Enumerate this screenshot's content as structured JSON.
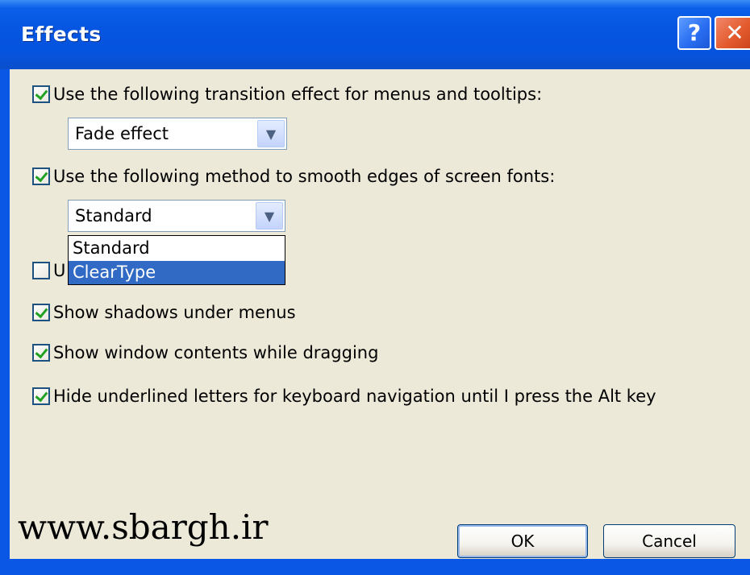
{
  "window": {
    "title": "Effects",
    "help_label": "?",
    "close_label": "✕"
  },
  "options": {
    "transition": {
      "label": "Use the following transition effect for menus and tooltips:",
      "checked": true,
      "selected_value": "Fade effect"
    },
    "smoothing": {
      "label": "Use the following method to smooth edges of screen fonts:",
      "checked": true,
      "selected_value": "Standard",
      "dropdown_options": [
        "Standard",
        "ClearType"
      ],
      "highlighted_option": "ClearType"
    },
    "hidden_option": {
      "visible_text": "U",
      "checked": false
    },
    "shadows": {
      "label": "Show shadows under menus",
      "checked": true
    },
    "drag_contents": {
      "label": "Show window contents while dragging",
      "checked": true
    },
    "hide_underline": {
      "label": "Hide underlined letters for keyboard navigation until I press the Alt key",
      "checked": true
    }
  },
  "buttons": {
    "ok": "OK",
    "cancel": "Cancel"
  },
  "watermark": "www.sbargh.ir",
  "icons": {
    "help": "help-icon",
    "close": "close-icon",
    "dropdown": "chevron-down-icon",
    "check": "checkmark-icon"
  },
  "colors": {
    "titlebar": "#0656e2",
    "client_bg": "#ece9d8",
    "selection": "#316ac5",
    "checkmark": "#21a121",
    "close_button": "#e35b2e"
  }
}
